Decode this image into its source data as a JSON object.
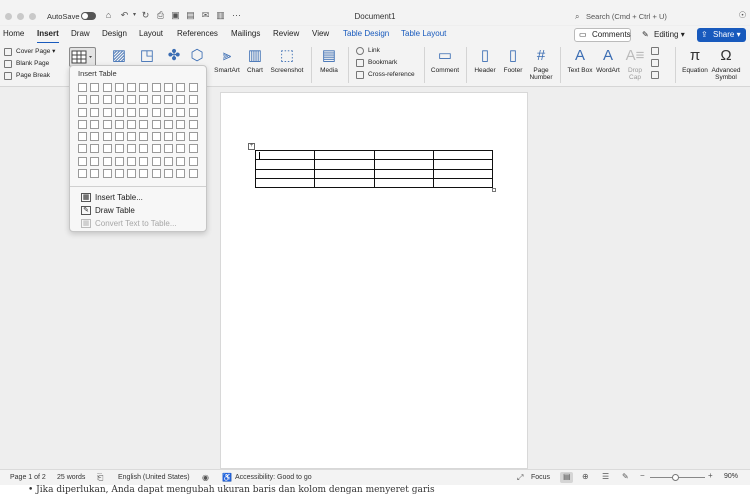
{
  "titlebar": {
    "autosave_label": "AutoSave",
    "document_title": "Document1",
    "search_placeholder": "Search (Cmd + Ctrl + U)"
  },
  "tabs": [
    {
      "label": "Home"
    },
    {
      "label": "Insert"
    },
    {
      "label": "Draw"
    },
    {
      "label": "Design"
    },
    {
      "label": "Layout"
    },
    {
      "label": "References"
    },
    {
      "label": "Mailings"
    },
    {
      "label": "Review"
    },
    {
      "label": "View"
    },
    {
      "label": "Table Design"
    },
    {
      "label": "Table Layout"
    }
  ],
  "actions": {
    "comments": "Comments",
    "editing": "Editing",
    "share": "Share"
  },
  "ribbon": {
    "cover_page": "Cover Page",
    "blank_page": "Blank Page",
    "page_break": "Page Break",
    "smartart": "SmartArt",
    "chart": "Chart",
    "screenshot": "Screenshot",
    "media": "Media",
    "link": "Link",
    "bookmark": "Bookmark",
    "cross_reference": "Cross-reference",
    "comment": "Comment",
    "header": "Header",
    "footer": "Footer",
    "page_number_1": "Page",
    "page_number_2": "Number",
    "text_box": "Text Box",
    "wordart": "WordArt",
    "drop_cap_1": "Drop",
    "drop_cap_2": "Cap",
    "equation": "Equation",
    "advanced_symbol_1": "Advanced",
    "advanced_symbol_2": "Symbol"
  },
  "insert_table_menu": {
    "title": "Insert Table",
    "grid_columns": 10,
    "grid_rows": 8,
    "items": [
      {
        "label": "Insert Table...",
        "enabled": true
      },
      {
        "label": "Draw Table",
        "enabled": true
      },
      {
        "label": "Convert Text to Table...",
        "enabled": false
      }
    ]
  },
  "document": {
    "table_rows": 4,
    "table_cols": 4
  },
  "statusbar": {
    "page": "Page 1 of 2",
    "words": "25 words",
    "language": "English (United States)",
    "accessibility": "Accessibility: Good to go",
    "focus": "Focus",
    "zoom": "90%"
  },
  "background_text": "• Jika diperlukan, Anda dapat mengubah ukuran baris dan kolom dengan menyeret garis"
}
